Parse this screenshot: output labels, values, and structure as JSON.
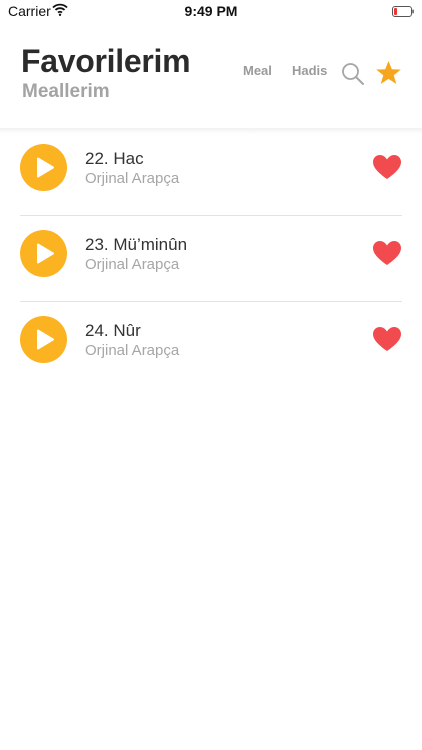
{
  "status_bar": {
    "carrier": "Carrier",
    "time": "9:49 PM"
  },
  "header": {
    "title": "Favorilerim",
    "subtitle": "Meallerim",
    "nav": {
      "meal_label": "Meal",
      "hadis_label": "Hadis"
    }
  },
  "colors": {
    "accent": "#fbb321",
    "star": "#f7a51d",
    "heart": "#f14b4f",
    "muted_text": "#a6a6a6"
  },
  "items": [
    {
      "title": "22. Hac",
      "subtitle": "Orjinal Arapça"
    },
    {
      "title": "23. Mü’minûn",
      "subtitle": "Orjinal Arapça"
    },
    {
      "title": "24. Nûr",
      "subtitle": "Orjinal Arapça"
    }
  ]
}
